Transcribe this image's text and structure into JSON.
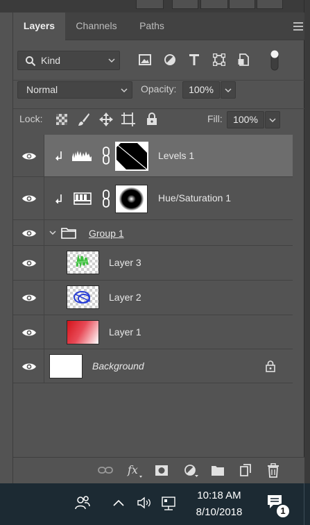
{
  "tabs": [
    {
      "label": "Layers",
      "active": true
    },
    {
      "label": "Channels",
      "active": false
    },
    {
      "label": "Paths",
      "active": false
    }
  ],
  "filter": {
    "kind_label": "Kind"
  },
  "blend": {
    "mode": "Normal",
    "opacity_label": "Opacity:",
    "opacity_value": "100%"
  },
  "lock": {
    "label": "Lock:",
    "fill_label": "Fill:",
    "fill_value": "100%"
  },
  "layers": [
    {
      "name": "Levels 1",
      "type": "adjustment-levels",
      "selected": true,
      "clipped": true
    },
    {
      "name": "Hue/Saturation 1",
      "type": "adjustment-hue-saturation",
      "selected": false,
      "clipped": true
    },
    {
      "name": "Group 1",
      "type": "group",
      "expanded": true
    },
    {
      "name": "Layer 3",
      "type": "pixel",
      "indented": true
    },
    {
      "name": "Layer 2",
      "type": "pixel",
      "indented": true
    },
    {
      "name": "Layer 1",
      "type": "pixel",
      "indented": true
    },
    {
      "name": "Background",
      "type": "background",
      "locked": true
    }
  ],
  "taskbar": {
    "time": "10:18 AM",
    "date": "8/10/2018",
    "notification_count": "1"
  },
  "colors": {
    "panel_bg": "#535353",
    "selected_row": "#6d6d6d",
    "taskbar_bg": "#1c2a33"
  }
}
